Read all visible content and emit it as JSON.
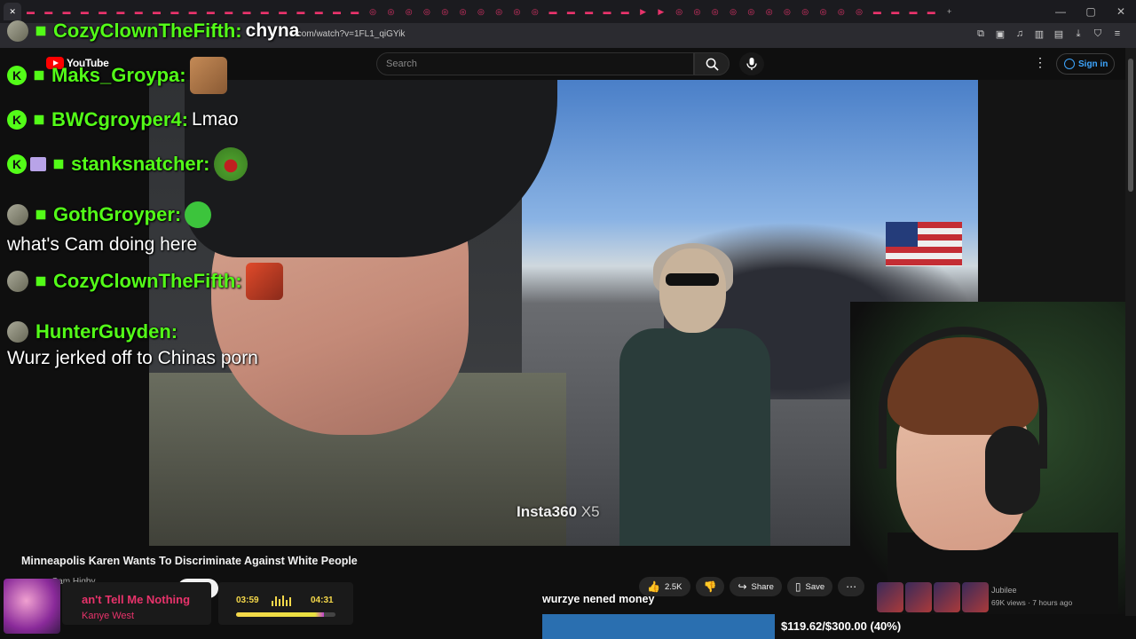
{
  "browser": {
    "url": "chyna.com/watch?v=1FL1_qiGYik",
    "url_host": "chyna",
    "url_rest": ".com/watch?v=1FL1_qiGYik"
  },
  "youtube": {
    "logo_text": "YouTube",
    "search_placeholder": "Search",
    "signin_label": "Sign in"
  },
  "video": {
    "watermark": "Insta360",
    "watermark_suffix": "X5",
    "title": "Minneapolis Karen Wants To Discriminate Against White People",
    "channel": "Cam Higby",
    "actions": {
      "likes": "2.5K",
      "share_label": "Share",
      "save_label": "Save"
    },
    "related": {
      "channel": "Jubilee",
      "meta": "69K views · 7 hours ago"
    }
  },
  "chat": [
    {
      "user": "CozyClownTheFifth:",
      "text": "chyna"
    },
    {
      "user": "Maks_Groypa:",
      "text": ""
    },
    {
      "user": "BWCgroyper4:",
      "text": "Lmao"
    },
    {
      "user": "stanksnatcher:",
      "text": ""
    },
    {
      "user": "GothGroyper:",
      "text": "what's Cam doing here"
    },
    {
      "user": "CozyClownTheFifth:",
      "text": ""
    },
    {
      "user": "HunterGuyden:",
      "text": "Wurz jerked off to Chinas porn"
    }
  ],
  "music": {
    "title": "an't Tell Me Nothing",
    "artist": "Kanye West",
    "current": "03:59",
    "total": "04:31",
    "progress": 0.88
  },
  "goal": {
    "message": "wurzye nened money",
    "label": "$119.62/$300.00 (40%)",
    "fraction": 0.4
  },
  "colors": {
    "chat_username": "#53fc18",
    "music_accent": "#e8336b",
    "goal_fill": "#2a6fb0",
    "yt_red": "#ff0000"
  }
}
